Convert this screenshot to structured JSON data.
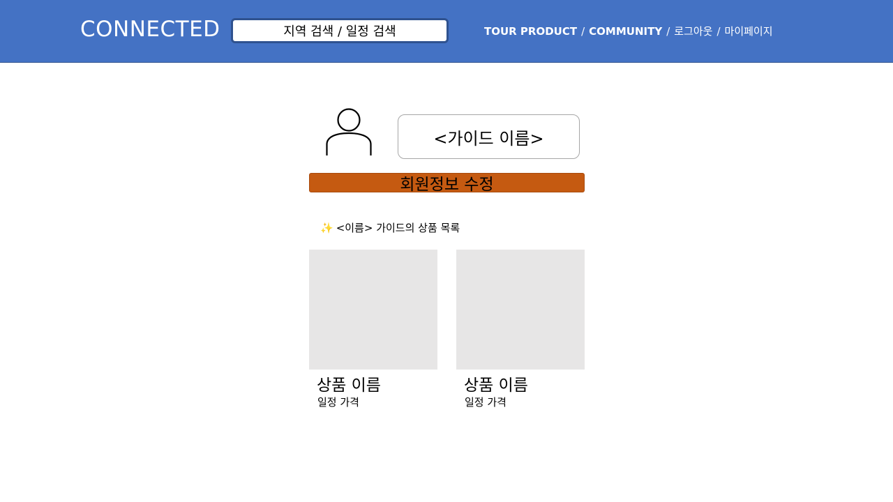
{
  "header": {
    "brand": "CONNECTED",
    "search_label": "지역 검색 / 일정 검색",
    "nav": {
      "tour_product": "TOUR PRODUCT",
      "sep1": "/",
      "community": "COMMUNITY",
      "sep2": "/",
      "logout": "로그아웃",
      "sep3": "/",
      "mypage": "마이페이지"
    },
    "background_color": "#4472c4"
  },
  "profile": {
    "avatar_icon": "user-icon",
    "guide_name": "<가이드 이름>",
    "edit_button_label": "회원정보 수정",
    "edit_button_color": "#c55a11"
  },
  "products": {
    "title_icon": "✨",
    "title": "<이름> 가이드의 상품 목록",
    "items": [
      {
        "name": "상품 이름",
        "meta": "일정 가격"
      },
      {
        "name": "상품 이름",
        "meta": "일정 가격"
      }
    ]
  }
}
